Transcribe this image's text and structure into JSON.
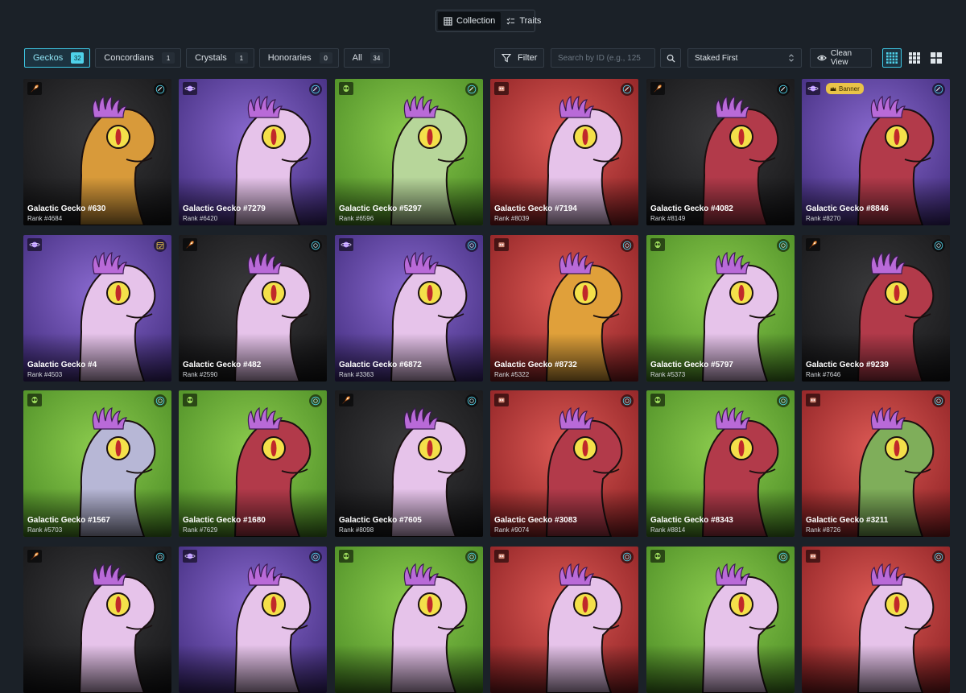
{
  "view_toggle": {
    "collection_label": "Collection",
    "traits_label": "Traits",
    "active": "collection"
  },
  "filter_bar": {
    "tabs": [
      {
        "label": "Geckos",
        "count": "32",
        "active": true
      },
      {
        "label": "Concordians",
        "count": "1",
        "active": false
      },
      {
        "label": "Crystals",
        "count": "1",
        "active": false
      },
      {
        "label": "Honoraries",
        "count": "0",
        "active": false
      },
      {
        "label": "All",
        "count": "34",
        "active": false
      }
    ],
    "filter_label": "Filter",
    "search_placeholder": "Search by ID (e.g., 125",
    "sort_value": "Staked First",
    "clean_view_label": "Clean View",
    "grid_sizes": [
      "small-grid",
      "medium-grid",
      "large-grid"
    ],
    "active_grid": "small-grid"
  },
  "colors": {
    "page_bg": "#1b2128",
    "accent": "#3ec9e6",
    "bg_black": "#2a2a2c",
    "bg_purple": "#6a4aa8",
    "bg_green": "#6fae3a",
    "bg_red": "#c23a3a",
    "banner": "#e9c348"
  },
  "cards": [
    {
      "title": "Galactic Gecko #630",
      "rank": "Rank #4684",
      "bg": "black",
      "skin": "#d89a3a",
      "badge_left": "rocket-icon",
      "badge_right": "orbit-icon"
    },
    {
      "title": "Galactic Gecko #7279",
      "rank": "Rank #6420",
      "bg": "purple",
      "skin": "#e6c3ea",
      "badge_left": "planet-icon",
      "badge_right": "orbit-icon"
    },
    {
      "title": "Galactic Gecko #5297",
      "rank": "Rank #6596",
      "bg": "green",
      "skin": "#b7d69a",
      "badge_left": "alien-icon",
      "badge_right": "orbit-icon"
    },
    {
      "title": "Galactic Gecko #7194",
      "rank": "Rank #8039",
      "bg": "red",
      "skin": "#e6c3ea",
      "badge_left": "robot-icon",
      "badge_right": "orbit-icon"
    },
    {
      "title": "Galactic Gecko #4082",
      "rank": "Rank #8149",
      "bg": "black",
      "skin": "#b23a4a",
      "badge_left": "rocket-icon",
      "badge_right": "orbit-icon"
    },
    {
      "title": "Galactic Gecko #8846",
      "rank": "Rank #8270",
      "bg": "purple",
      "skin": "#b23a4a",
      "badge_left": "planet-icon",
      "badge_right": "orbit-icon",
      "banner": "Banner"
    },
    {
      "title": "Galactic Gecko #4",
      "rank": "Rank #4503",
      "bg": "purple",
      "skin": "#e6c3ea",
      "badge_left": "planet-icon",
      "badge_right": "calendar-icon"
    },
    {
      "title": "Galactic Gecko #482",
      "rank": "Rank #2590",
      "bg": "black",
      "skin": "#e6c3ea",
      "badge_left": "rocket-icon",
      "badge_right": "staked-icon"
    },
    {
      "title": "Galactic Gecko #6872",
      "rank": "Rank #3363",
      "bg": "purple",
      "skin": "#e6c3ea",
      "badge_left": "planet-icon",
      "badge_right": "staked-icon"
    },
    {
      "title": "Galactic Gecko #8732",
      "rank": "Rank #5322",
      "bg": "red",
      "skin": "#e0a03a",
      "badge_left": "robot-icon",
      "badge_right": "staked-icon"
    },
    {
      "title": "Galactic Gecko #5797",
      "rank": "Rank #5373",
      "bg": "green",
      "skin": "#e6c3ea",
      "badge_left": "alien-icon",
      "badge_right": "staked-icon"
    },
    {
      "title": "Galactic Gecko #9239",
      "rank": "Rank #7646",
      "bg": "black",
      "skin": "#b23a4a",
      "badge_left": "rocket-icon",
      "badge_right": "staked-icon"
    },
    {
      "title": "Galactic Gecko #1567",
      "rank": "Rank #5703",
      "bg": "green",
      "skin": "#b7b7d6",
      "badge_left": "alien-icon",
      "badge_right": "staked-icon"
    },
    {
      "title": "Galactic Gecko #1680",
      "rank": "Rank #7629",
      "bg": "green",
      "skin": "#b23a4a",
      "badge_left": "alien-icon",
      "badge_right": "staked-icon"
    },
    {
      "title": "Galactic Gecko #7605",
      "rank": "Rank #8098",
      "bg": "black",
      "skin": "#e6c3ea",
      "badge_left": "rocket-icon",
      "badge_right": "staked-icon"
    },
    {
      "title": "Galactic Gecko #3083",
      "rank": "Rank #9074",
      "bg": "red",
      "skin": "#b23a4a",
      "badge_left": "robot-icon",
      "badge_right": "staked-icon"
    },
    {
      "title": "Galactic Gecko #8343",
      "rank": "Rank #8814",
      "bg": "green",
      "skin": "#b23a4a",
      "badge_left": "alien-icon",
      "badge_right": "staked-icon"
    },
    {
      "title": "Galactic Gecko #3211",
      "rank": "Rank #8726",
      "bg": "red",
      "skin": "#7fae5a",
      "badge_left": "robot-icon",
      "badge_right": "staked-icon"
    },
    {
      "title": "",
      "rank": "",
      "bg": "black",
      "skin": "#e6c3ea",
      "badge_left": "rocket-icon",
      "badge_right": "staked-icon"
    },
    {
      "title": "",
      "rank": "",
      "bg": "purple",
      "skin": "#e6c3ea",
      "badge_left": "planet-icon",
      "badge_right": "staked-icon"
    },
    {
      "title": "",
      "rank": "",
      "bg": "green",
      "skin": "#e6c3ea",
      "badge_left": "alien-icon",
      "badge_right": "staked-icon"
    },
    {
      "title": "",
      "rank": "",
      "bg": "red",
      "skin": "#e6c3ea",
      "badge_left": "robot-icon",
      "badge_right": "staked-icon"
    },
    {
      "title": "",
      "rank": "",
      "bg": "green",
      "skin": "#e6c3ea",
      "badge_left": "alien-icon",
      "badge_right": "staked-icon"
    },
    {
      "title": "",
      "rank": "",
      "bg": "red",
      "skin": "#e6c3ea",
      "badge_left": "robot-icon",
      "badge_right": "staked-icon"
    }
  ]
}
